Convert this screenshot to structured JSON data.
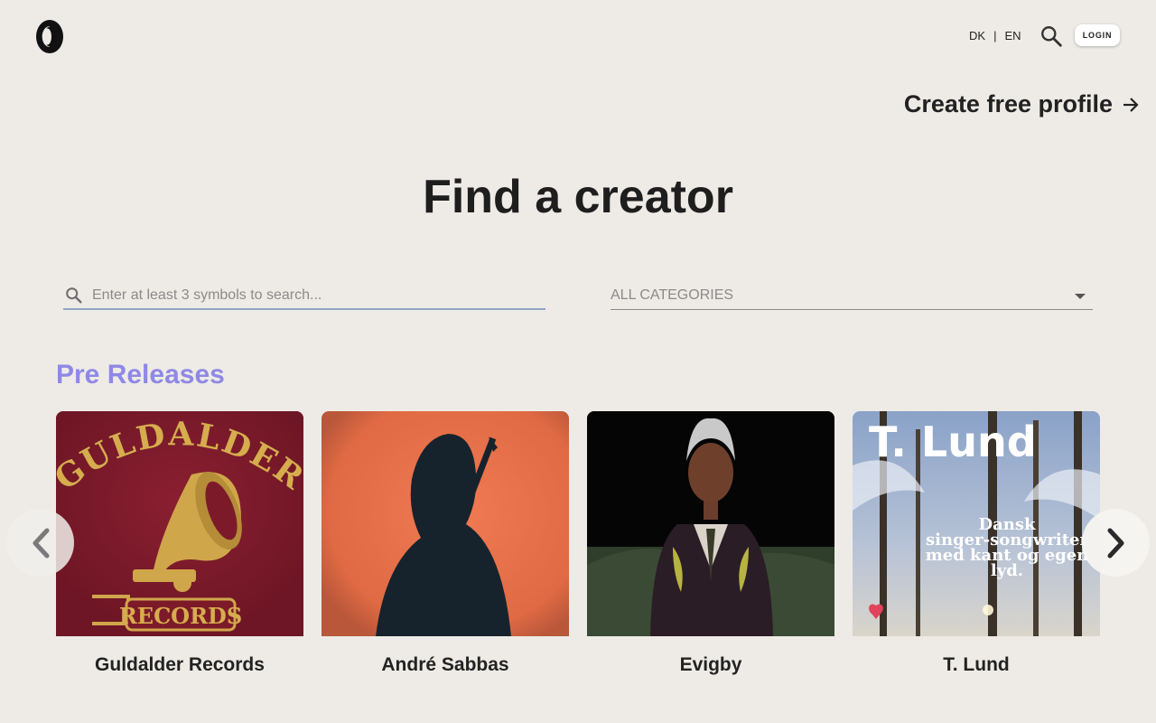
{
  "header": {
    "lang_dk": "DK",
    "lang_separator": "|",
    "lang_en": "EN",
    "login_label": "LOGIN"
  },
  "create_profile": {
    "label": "Create free profile"
  },
  "title": "Find a creator",
  "search": {
    "placeholder": "Enter at least 3 symbols to search..."
  },
  "category": {
    "selected": "ALL CATEGORIES"
  },
  "section": {
    "title": "Pre Releases",
    "title_color": "#8f88e6",
    "cards": [
      {
        "name": "Guldalder Records",
        "art_text_top": "GULDALDER",
        "art_text_bottom": "RECORDS"
      },
      {
        "name": "André Sabbas"
      },
      {
        "name": "Evigby"
      },
      {
        "name": "T. Lund",
        "art_title": "T. Lund",
        "art_caption_1": "Dansk",
        "art_caption_2": "singer-songwriter",
        "art_caption_3": "med kant og egen",
        "art_caption_4": "lyd."
      }
    ]
  },
  "icons": {
    "logo": "logo-icon",
    "search": "search-icon",
    "arrow": "arrow-right-icon",
    "caret": "caret-down-icon",
    "prev": "chevron-left-icon",
    "next": "chevron-right-icon"
  }
}
